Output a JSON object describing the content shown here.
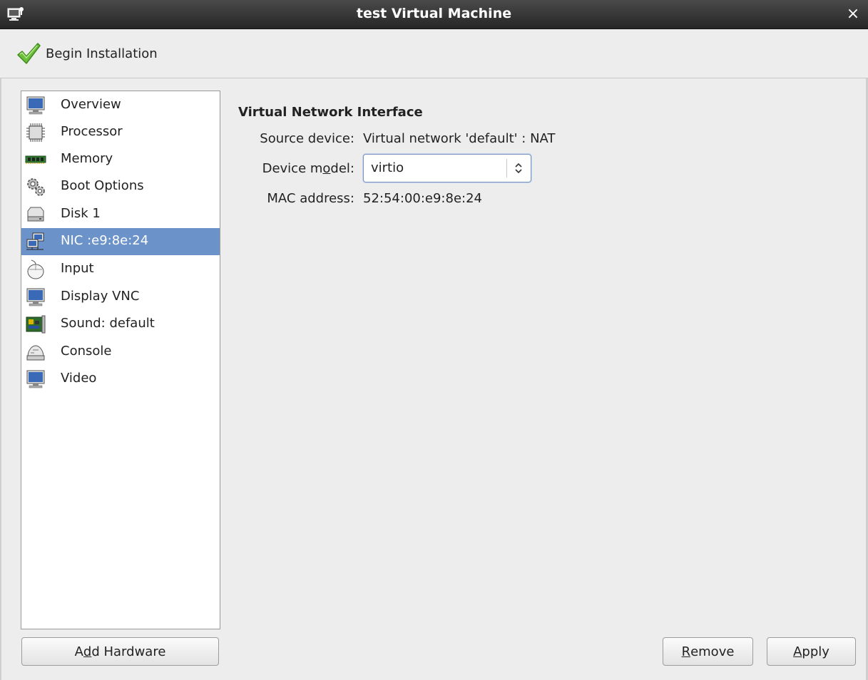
{
  "window": {
    "title": "test Virtual Machine",
    "close_glyph": "×"
  },
  "toolbar": {
    "begin_label": "Begin Installation"
  },
  "sidebar": {
    "items": [
      {
        "label": "Overview",
        "icon": "monitor-icon",
        "selected": false
      },
      {
        "label": "Processor",
        "icon": "cpu-icon",
        "selected": false
      },
      {
        "label": "Memory",
        "icon": "memory-icon",
        "selected": false
      },
      {
        "label": "Boot Options",
        "icon": "gears-icon",
        "selected": false
      },
      {
        "label": "Disk 1",
        "icon": "disk-icon",
        "selected": false
      },
      {
        "label": "NIC :e9:8e:24",
        "icon": "network-icon",
        "selected": true
      },
      {
        "label": "Input",
        "icon": "mouse-icon",
        "selected": false
      },
      {
        "label": "Display VNC",
        "icon": "monitor-icon",
        "selected": false
      },
      {
        "label": "Sound: default",
        "icon": "sound-card-icon",
        "selected": false
      },
      {
        "label": "Console",
        "icon": "console-icon",
        "selected": false
      },
      {
        "label": "Video",
        "icon": "monitor-icon",
        "selected": false
      }
    ]
  },
  "details": {
    "section_title": "Virtual Network Interface",
    "source_label": "Source device:",
    "source_value": "Virtual network 'default' : NAT",
    "model_label_pre": "Device m",
    "model_label_mnemonic": "o",
    "model_label_post": "del:",
    "model_value": "virtio",
    "mac_label": "MAC address:",
    "mac_value": "52:54:00:e9:8e:24"
  },
  "buttons": {
    "add_pre": "A",
    "add_mnemonic": "d",
    "add_post": "d Hardware",
    "remove_mnemonic": "R",
    "remove_post": "emove",
    "apply_mnemonic": "A",
    "apply_post": "pply"
  },
  "colors": {
    "selection": "#6b92c9",
    "titlebar": "#2e2e2e",
    "background": "#ededed"
  }
}
